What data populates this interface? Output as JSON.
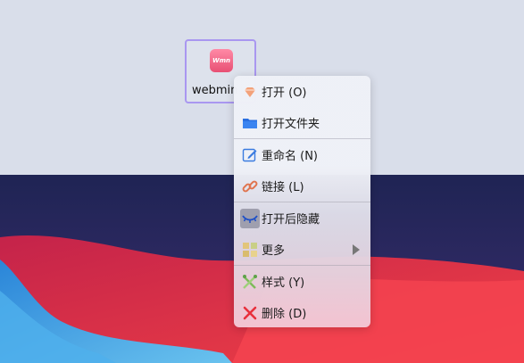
{
  "desktop_icon": {
    "label": "webmin",
    "badge_text": "Wmn"
  },
  "context_menu": {
    "items": [
      {
        "label": "打开 (O)",
        "icon": "open-diamond-icon"
      },
      {
        "label": "打开文件夹",
        "icon": "folder-icon"
      },
      {
        "label": "重命名 (N)",
        "icon": "rename-pencil-icon"
      },
      {
        "label": "链接 (L)",
        "icon": "link-chain-icon"
      },
      {
        "label": "打开后隐藏",
        "icon": "hide-eye-icon"
      },
      {
        "label": "更多",
        "icon": "more-grid-icon"
      },
      {
        "label": "样式 (Y)",
        "icon": "style-icon"
      },
      {
        "label": "删除 (D)",
        "icon": "delete-x-icon"
      }
    ]
  },
  "colors": {
    "selection_border": "#a997f0",
    "delete_red": "#e8303c",
    "folder_blue": "#2a6fe0"
  }
}
